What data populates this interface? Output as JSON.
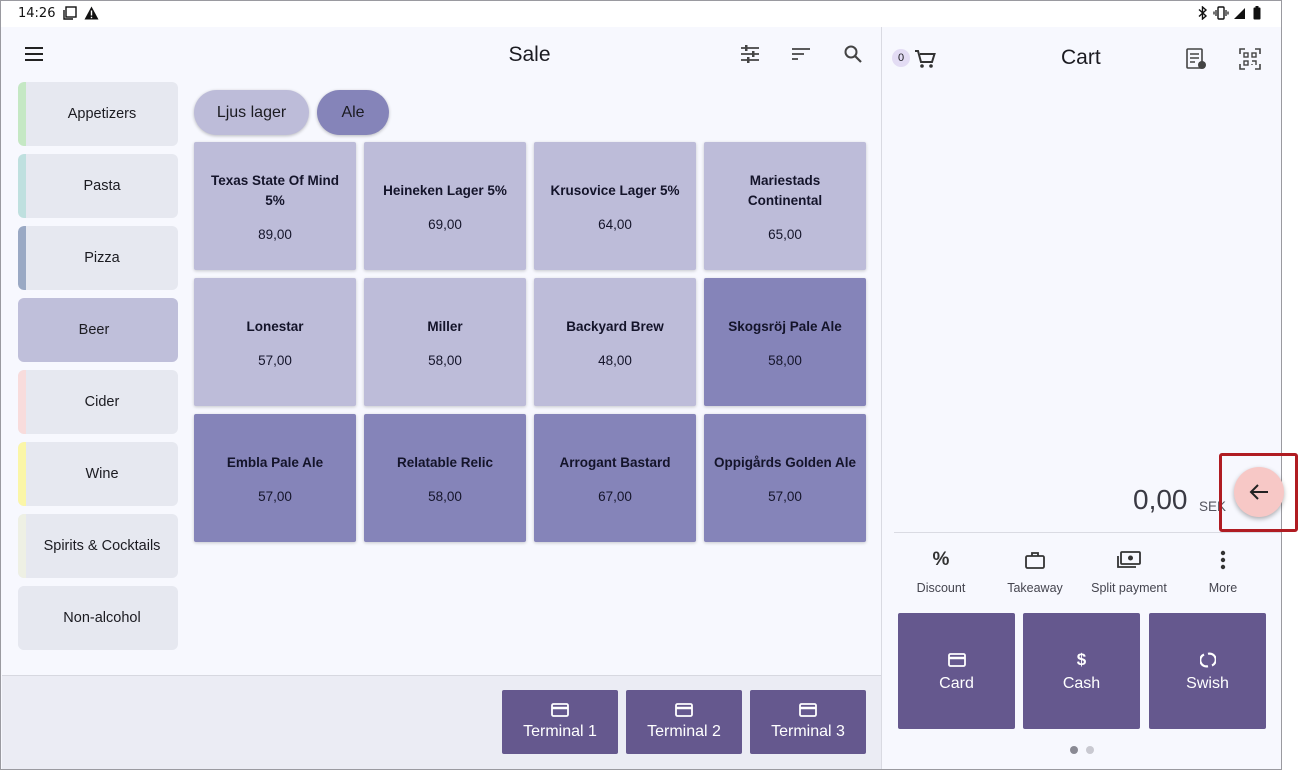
{
  "status_bar": {
    "time": "14:26"
  },
  "header": {
    "title": "Sale"
  },
  "categories": [
    {
      "label": "Appetizers",
      "color": "#c5e8c4"
    },
    {
      "label": "Pasta",
      "color": "#bfe0df"
    },
    {
      "label": "Pizza",
      "color": "#9aa9c4"
    },
    {
      "label": "Beer",
      "color": "#bfbfda"
    },
    {
      "label": "Cider",
      "color": "#f8dcdc"
    },
    {
      "label": "Wine",
      "color": "#fbf6a8"
    },
    {
      "label": "Spirits & Cocktails",
      "color": "#eef0e4"
    },
    {
      "label": "Non-alcohol",
      "color": "#e6e8f0"
    }
  ],
  "selected_category": "Beer",
  "filters": [
    {
      "label": "Ljus lager",
      "active": false
    },
    {
      "label": "Ale",
      "active": true
    }
  ],
  "products": [
    {
      "name": "Texas State Of Mind 5%",
      "price": "89,00",
      "shade": "light"
    },
    {
      "name": "Heineken Lager 5%",
      "price": "69,00",
      "shade": "light"
    },
    {
      "name": "Krusovice Lager 5%",
      "price": "64,00",
      "shade": "light"
    },
    {
      "name": "Mariestads Continental",
      "price": "65,00",
      "shade": "light"
    },
    {
      "name": "Lonestar",
      "price": "57,00",
      "shade": "light"
    },
    {
      "name": "Miller",
      "price": "58,00",
      "shade": "light"
    },
    {
      "name": "Backyard Brew",
      "price": "48,00",
      "shade": "light"
    },
    {
      "name": "Skogsröj Pale Ale",
      "price": "58,00",
      "shade": "dark"
    },
    {
      "name": "Embla Pale Ale",
      "price": "57,00",
      "shade": "dark"
    },
    {
      "name": "Relatable Relic",
      "price": "58,00",
      "shade": "dark"
    },
    {
      "name": "Arrogant Bastard",
      "price": "67,00",
      "shade": "dark"
    },
    {
      "name": "Oppigårds Golden Ale",
      "price": "57,00",
      "shade": "dark"
    }
  ],
  "terminals": [
    "Terminal 1",
    "Terminal 2",
    "Terminal 3"
  ],
  "cart": {
    "title": "Cart",
    "item_count": "0",
    "total": "0,00",
    "currency": "SEK",
    "actions": [
      "Discount",
      "Takeaway",
      "Split payment",
      "More"
    ],
    "payments": [
      {
        "label": "Card",
        "icon": "card-icon"
      },
      {
        "label": "Cash",
        "icon": "dollar-icon"
      },
      {
        "label": "Swish",
        "icon": "swish-icon"
      }
    ],
    "page_indicator": {
      "pages": 2,
      "current": 1
    }
  },
  "colors": {
    "accent": "#65588e",
    "tile_light": "#bdbcd9",
    "tile_dark": "#8584b9",
    "fab": "#f7c8c6",
    "highlight": "#b01c22"
  }
}
